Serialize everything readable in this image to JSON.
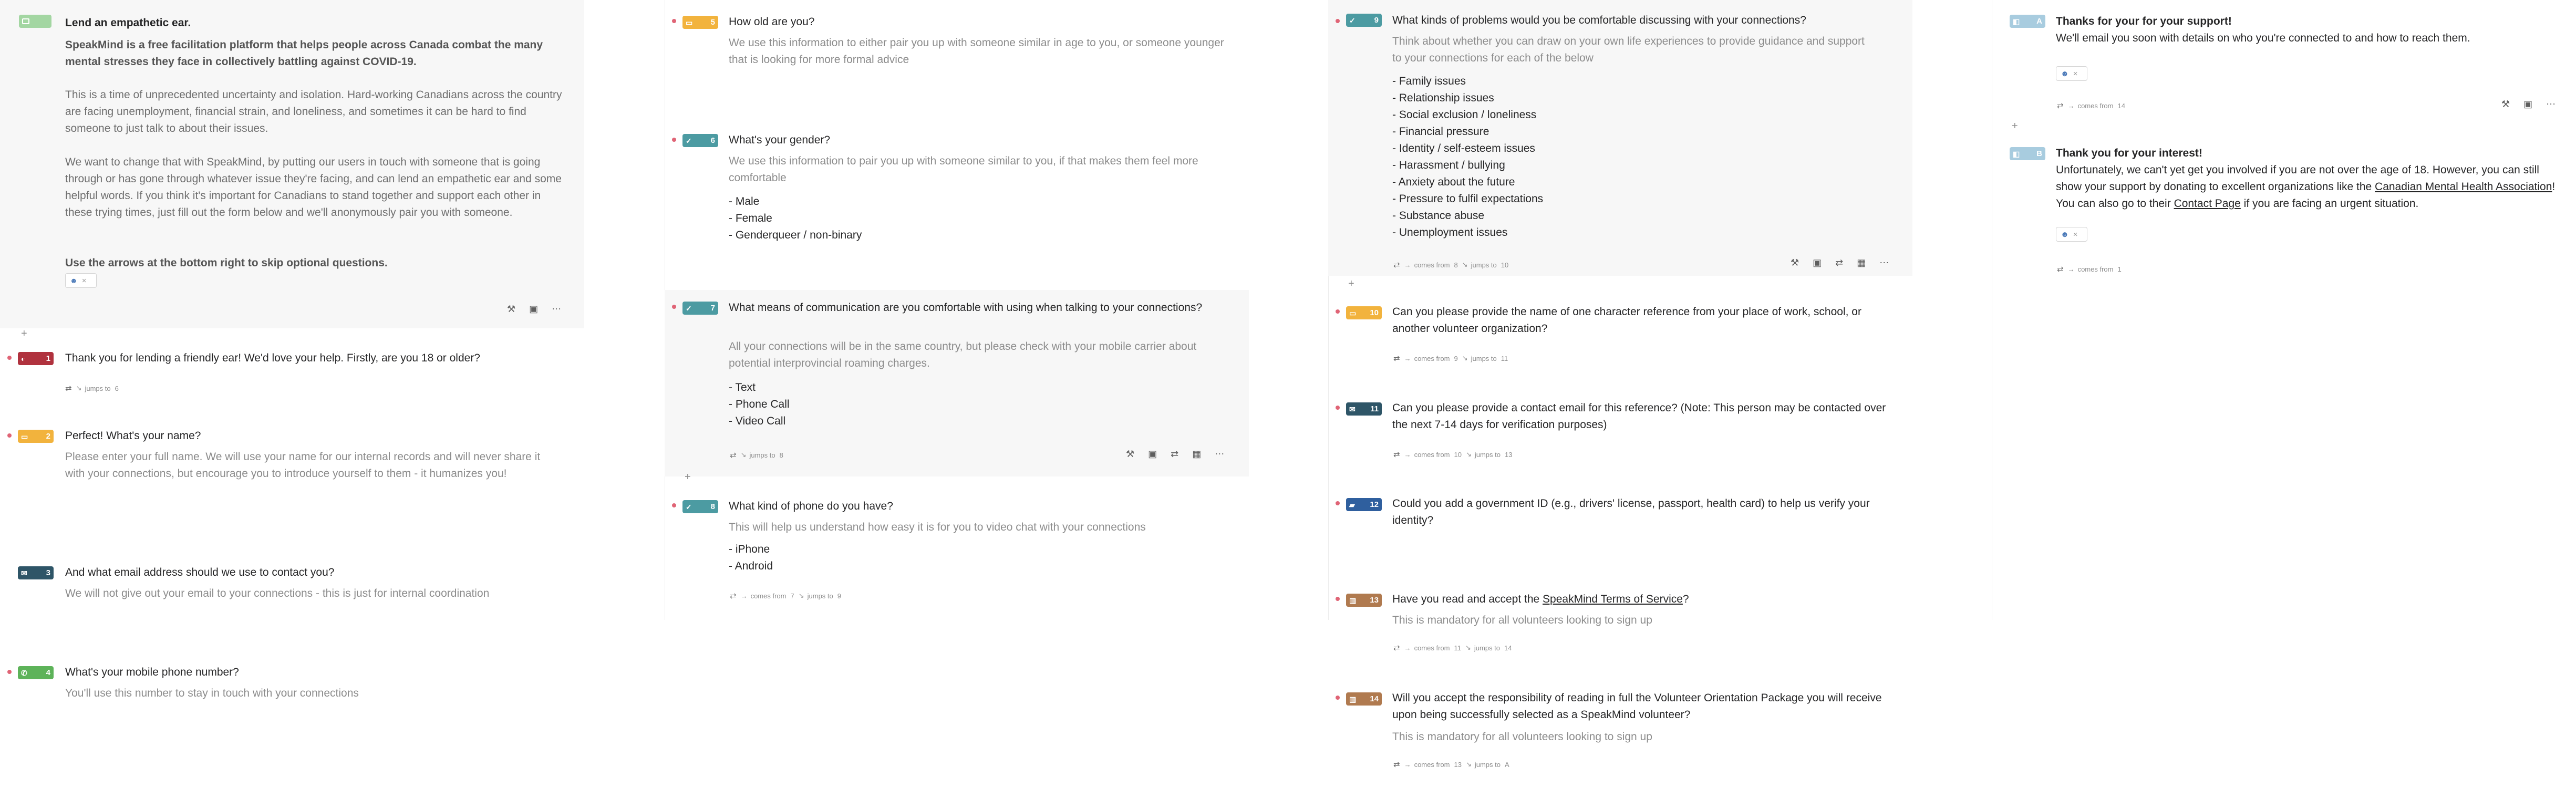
{
  "colors": {
    "welcome": "#a3d6a2",
    "yesno": "#b0323e",
    "short_text": "#f2b33d",
    "email": "#2e5567",
    "phone": "#5db359",
    "multiple_choice": "#4c9ba2",
    "file_upload": "#2f5f9e",
    "legal": "#b07a4f",
    "thankyou": "#a8ccdf"
  },
  "welcome": {
    "title": "Lend an empathetic ear.",
    "intro": "SpeakMind is a free facilitation platform that helps people across Canada combat the many mental stresses they face in collectively battling against COVID-19.",
    "para1": "This is a time of unprecedented uncertainty and isolation. Hard-working Canadians across the country are facing unemployment, financial strain, and loneliness, and sometimes it can be hard to find someone to just talk to about their issues.",
    "para2": "We want to change that with SpeakMind, by putting our users in touch with someone that is going through or has gone through whatever issue they're facing, and can lend an empathetic ear and some helpful words. If you think it's important for Canadians to stand together and support each other in these trying times, just fill out the form below and we'll anonymously pair you with someone.",
    "hint": "Use the arrows at the bottom right to skip optional questions."
  },
  "questions": {
    "q1": {
      "num": "1",
      "title": "Thank you for lending a friendly ear!  We'd love your help. Firstly, are you 18 or older?",
      "jumps": "jumps to",
      "jumps_num": "6"
    },
    "q2": {
      "num": "2",
      "title": "Perfect! What's your name?",
      "desc": "Please enter your full name. We will use your name for our internal records and will never share it with your connections, but encourage you to introduce yourself to them - it humanizes you!"
    },
    "q3": {
      "num": "3",
      "title": "And what email address should we use to contact you?",
      "desc": "We will not give out your email to your connections - this is just for internal coordination"
    },
    "q4": {
      "num": "4",
      "title": "What's your mobile phone number?",
      "desc": "You'll use this number to stay in touch with your connections"
    },
    "q5": {
      "num": "5",
      "title": "How old are you?",
      "desc": "We use this information to either pair you up with someone similar in age to you, or someone younger that is looking for more formal advice"
    },
    "q6": {
      "num": "6",
      "title": "What's your gender?",
      "desc": "We use this information to pair you up with someone similar to you, if that makes them feel more comfortable",
      "options": [
        "- Male",
        "- Female",
        "- Genderqueer / non-binary"
      ]
    },
    "q7": {
      "num": "7",
      "title": "What means of communication are you comfortable with using when talking to your connections?",
      "desc": "All your connections will be in the same country, but please check with your mobile carrier about potential interprovincial roaming charges.",
      "options": [
        "- Text",
        "- Phone Call",
        "- Video Call"
      ],
      "jumps": "jumps to",
      "jumps_num": "8"
    },
    "q8": {
      "num": "8",
      "title": "What kind of phone do you have?",
      "desc": "This will help us understand how easy it is for you to video chat with your connections",
      "options": [
        "- iPhone",
        "- Android"
      ],
      "comes": "comes from",
      "comes_num": "7",
      "jumps": "jumps to",
      "jumps_num": "9"
    },
    "q9": {
      "num": "9",
      "title": "What kinds of problems would you be comfortable discussing with your connections?",
      "desc": "Think about whether you can draw on your own life experiences to provide guidance and support to your connections for each of the below",
      "options": [
        "- Family issues",
        "- Relationship issues",
        "- Social exclusion / loneliness",
        "- Financial pressure",
        "- Identity / self-esteem issues",
        "- Harassment / bullying",
        "- Anxiety about the future",
        "- Pressure to fulfil expectations",
        "- Substance abuse",
        "- Unemployment issues"
      ],
      "comes": "comes from",
      "comes_num": "8",
      "jumps": "jumps to",
      "jumps_num": "10"
    },
    "q10": {
      "num": "10",
      "title": "Can you please provide the name of one character reference from your place of work, school, or another volunteer organization?",
      "comes": "comes from",
      "comes_num": "9",
      "jumps": "jumps to",
      "jumps_num": "11"
    },
    "q11": {
      "num": "11",
      "title": "Can you please provide a contact email for this reference? (Note: This person may be contacted over the next 7-14 days for verification purposes)",
      "comes": "comes from",
      "comes_num": "10",
      "jumps": "jumps to",
      "jumps_num": "13"
    },
    "q12": {
      "num": "12",
      "title": "Could you add a government ID (e.g., drivers' license, passport, health card) to help us verify your identity?"
    },
    "q13": {
      "num": "13",
      "title_pre": "Have you read and accept the ",
      "title_link": "SpeakMind Terms of Service",
      "title_post": "?",
      "desc": "This is mandatory for all volunteers looking to sign up",
      "comes": "comes from",
      "comes_num": "11",
      "jumps": "jumps to",
      "jumps_num": "14"
    },
    "q14": {
      "num": "14",
      "title": "Will you accept the responsibility of reading in full the Volunteer Orientation Package you will receive upon being successfully selected as a SpeakMind volunteer?",
      "desc": "This is mandatory for all volunteers looking to sign up",
      "comes": "comes from",
      "comes_num": "13",
      "jumps": "jumps to",
      "jumps_num": "A"
    }
  },
  "thankyou": {
    "a": {
      "letter": "A",
      "title": "Thanks for your for your support!",
      "desc": "We'll email you soon with details on who you're connected to and how to reach them.",
      "comes": "comes from",
      "comes_num": "14"
    },
    "b": {
      "letter": "B",
      "title": "Thank you for your interest!",
      "desc_1": "Unfortunately, we can't yet get you involved if you are not over the age of 18. However, you can still show your support by donating to excellent organizations like the ",
      "link_1": "Canadian Mental Health Association",
      "desc_2": "! You can also go to their ",
      "link_2": "Contact Page",
      "desc_3": " if you are facing an urgent situation.",
      "comes": "comes from",
      "comes_num": "1"
    }
  },
  "icons": [
    "logic-icon",
    "image-icon",
    "more-icon",
    "settings-icon",
    "calculator-icon",
    "check-icon",
    "mail-icon",
    "phone-icon",
    "folder-icon",
    "legal-icon",
    "yesno-icon",
    "text-icon",
    "thankyou-icon",
    "share-icon",
    "social-icon"
  ]
}
